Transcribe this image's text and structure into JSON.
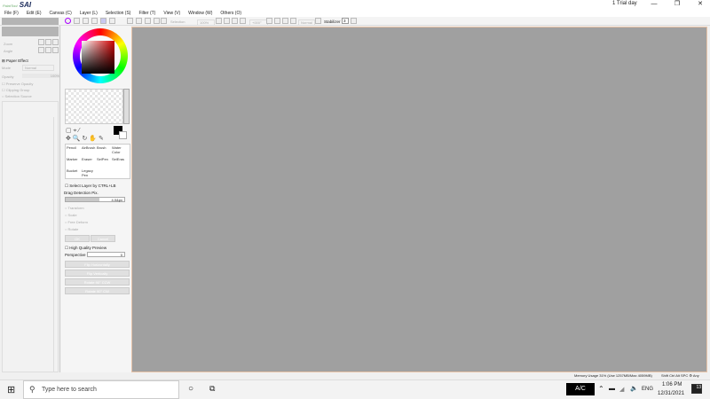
{
  "window": {
    "logo": "SAI",
    "logo_prefix": "PaintTool",
    "trial": "1 Trial day",
    "minimize": "—",
    "maximize": "❐",
    "close": "✕"
  },
  "menu": [
    "File (F)",
    "Edit (E)",
    "Canvas (C)",
    "Layer (L)",
    "Selection (S)",
    "Filter (T)",
    "View (V)",
    "Window (W)",
    "Others (O)"
  ],
  "toolbar": {
    "selection": "Selection",
    "zoom": "100%",
    "angle": "+000°",
    "blend": "Normal",
    "stabilizer_label": "Stabilizer",
    "stabilizer_value": "3"
  },
  "layer_panel": {
    "zoom_label": "Zoom",
    "angle_label": "Angle",
    "paper_effect": "Paper Effect",
    "mode_label": "Mode",
    "mode_value": "Normal",
    "opacity_label": "Opacity",
    "opacity_value": "100%",
    "checks": [
      "Preserve Opacity",
      "Clipping Group",
      "Selection Source"
    ]
  },
  "brushes": [
    "Pencil",
    "AirBrush",
    "Brush",
    "Water Color",
    "Marker",
    "Eraser",
    "SelPen",
    "SelEras",
    "Bucket",
    "Legacy Pen"
  ],
  "options": {
    "select_layer": "Select Layer by CTRL+LB",
    "drag_label": "Drag Detection Pix.",
    "drag_value": "4.0&px",
    "radios": [
      "Transform",
      "Scale",
      "Free Deform",
      "Rotate"
    ],
    "ok": "OK",
    "cancel": "Cancel",
    "hq": "High Quality Preview",
    "perspective": "Perspective",
    "perspective_value": "0",
    "buttons": [
      "Flip Horizontally",
      "Flip Vertically",
      "Rotate 90° CCW",
      "Rotate 90° CW"
    ]
  },
  "status": {
    "memory": "Memory Usage 31% (Use 1257MB/Max 4059MB)",
    "keys": "Shift Ctrl Alt SPC ⚙ Any"
  },
  "taskbar": {
    "search_placeholder": "Type here to search",
    "ac": "A/C",
    "lang": "ENG",
    "time": "1:06 PM",
    "date": "12/31/2021",
    "notif": "13"
  }
}
